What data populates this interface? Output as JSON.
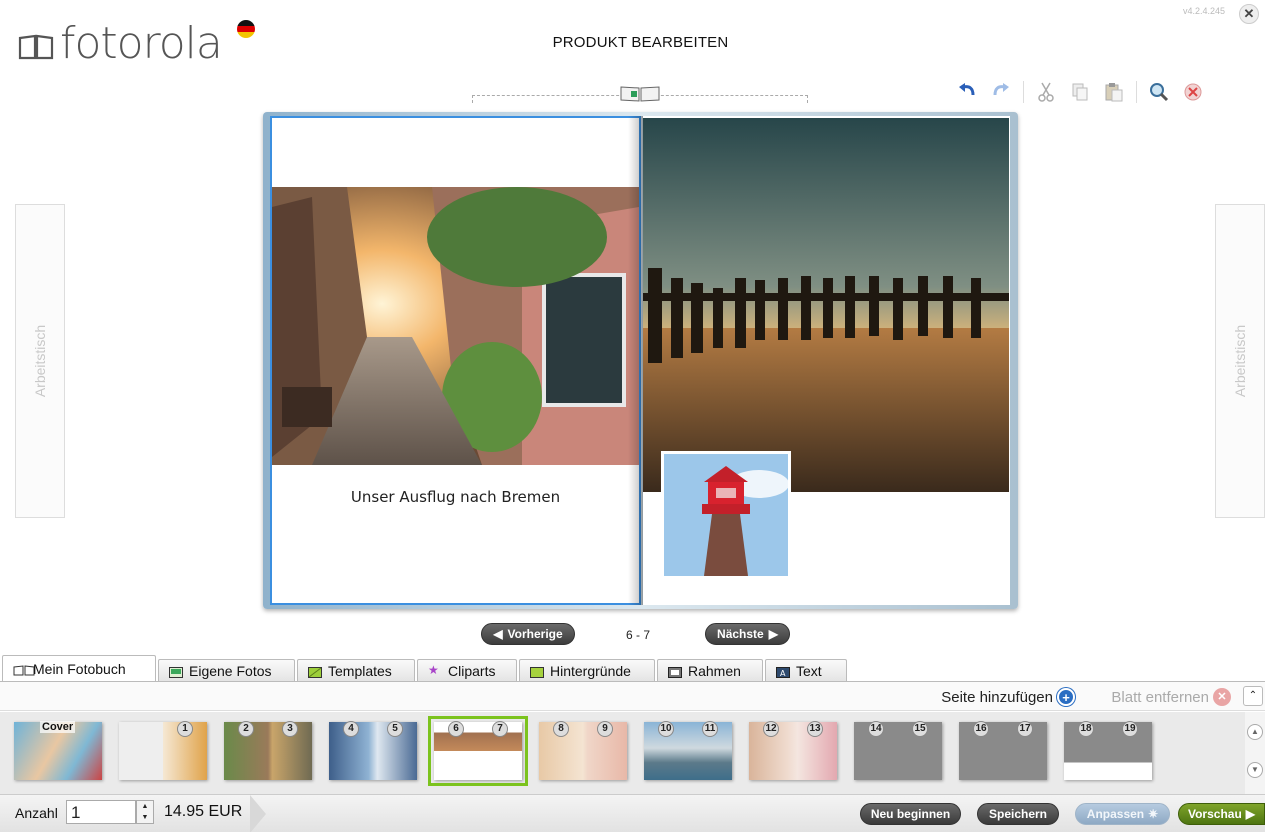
{
  "header": {
    "logo_text": "fotorola",
    "title": "PRODUKT BEARBEITEN",
    "version": "v4.2.4.245"
  },
  "toolbar": {
    "icons": [
      "undo-icon",
      "redo-icon",
      "cut-icon",
      "copy-icon",
      "paste-icon",
      "zoom-icon",
      "delete-icon"
    ]
  },
  "side_panels": {
    "left_label": "Arbeitstisch",
    "right_label": "Arbeitstisch"
  },
  "editor": {
    "caption": "Unser Ausflug nach Bremen",
    "page_indicator": "6 - 7",
    "prev_label": "Vorherige",
    "next_label": "Nächste"
  },
  "tabs": [
    {
      "label": "Mein Fotobuch",
      "icon": "book-icon",
      "active": true
    },
    {
      "label": "Eigene Fotos",
      "icon": "photo-icon"
    },
    {
      "label": "Templates",
      "icon": "template-icon"
    },
    {
      "label": "Cliparts",
      "icon": "star-icon"
    },
    {
      "label": "Hintergründe",
      "icon": "background-icon"
    },
    {
      "label": "Rahmen",
      "icon": "frame-icon"
    },
    {
      "label": "Text",
      "icon": "text-icon"
    }
  ],
  "actions": {
    "add_page": "Seite hinzufügen",
    "remove_sheet": "Blatt entfernen"
  },
  "thumbnails": [
    {
      "label": "Cover"
    },
    {
      "left": "",
      "right": "1"
    },
    {
      "left": "2",
      "right": "3"
    },
    {
      "left": "4",
      "right": "5"
    },
    {
      "left": "6",
      "right": "7",
      "selected": true
    },
    {
      "left": "8",
      "right": "9"
    },
    {
      "left": "10",
      "right": "11"
    },
    {
      "left": "12",
      "right": "13"
    },
    {
      "left": "14",
      "right": "15"
    },
    {
      "left": "16",
      "right": "17"
    },
    {
      "left": "18",
      "right": "19"
    }
  ],
  "footer": {
    "qty_label": "Anzahl",
    "qty_value": "1",
    "price": "14.95 EUR",
    "restart_label": "Neu beginnen",
    "save_label": "Speichern",
    "customize_label": "Anpassen",
    "preview_label": "Vorschau"
  },
  "colors": {
    "accent_blue": "#3b8fe0",
    "selected_green": "#7cc31e",
    "preview_green": "#5d8a18"
  }
}
